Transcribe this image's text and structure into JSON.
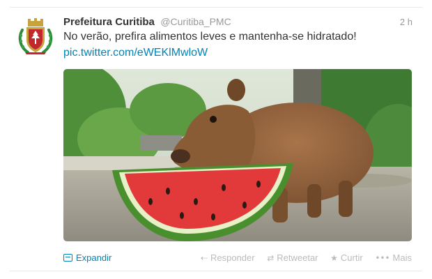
{
  "tweet": {
    "name": "Prefeitura Curitiba",
    "handle": "@Curitiba_PMC",
    "time": "2 h",
    "text": "No verão, prefira alimentos leves e mantenha-se hidratado!",
    "link": "pic.twitter.com/eWEKlMwloW"
  },
  "actions": {
    "expand": "Expandir",
    "reply": "Responder",
    "retweet": "Retweetar",
    "favorite": "Curtir",
    "more": "Mais"
  },
  "icons": {
    "expand": "expand-icon",
    "reply": "reply-icon",
    "retweet": "retweet-icon",
    "favorite": "star-icon",
    "more": "more-icon"
  },
  "colors": {
    "link": "#0084b4",
    "name": "#333333",
    "muted": "#999999",
    "action_muted": "#bbbbbb"
  }
}
